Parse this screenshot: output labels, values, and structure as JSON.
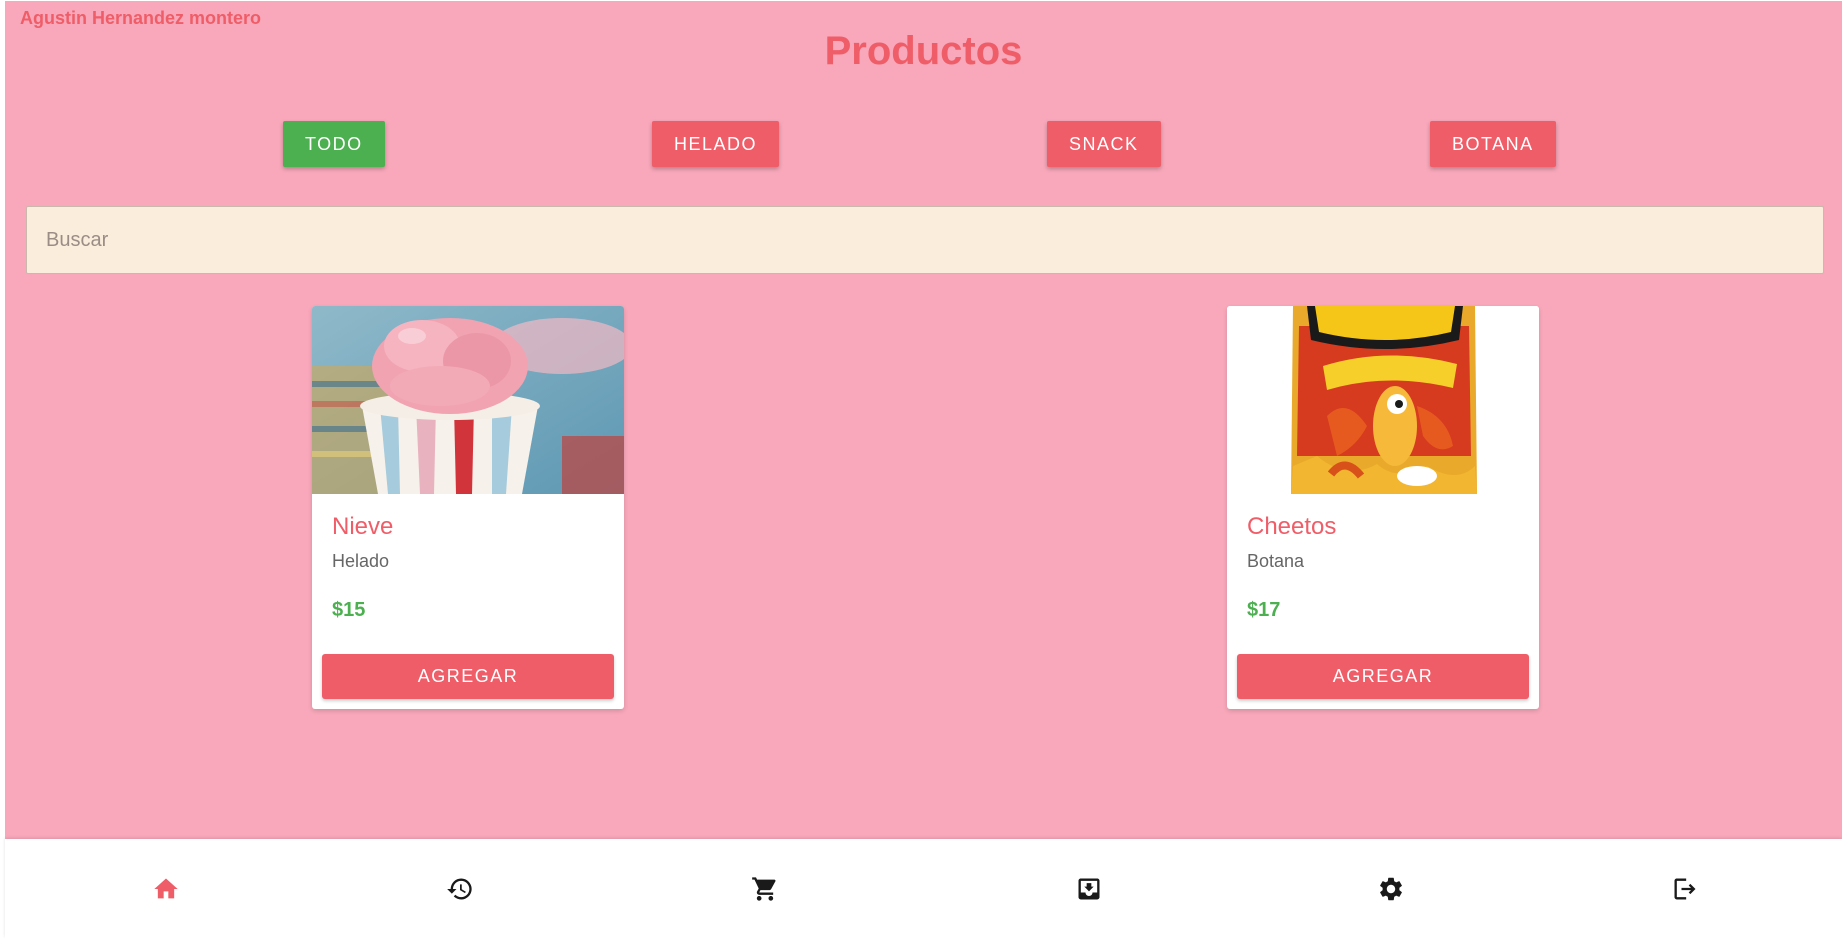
{
  "header": {
    "user_name": "Agustin Hernandez montero",
    "page_title": "Productos"
  },
  "filters": [
    {
      "label": "TODO",
      "active": true
    },
    {
      "label": "HELADO",
      "active": false
    },
    {
      "label": "SNACK",
      "active": false
    },
    {
      "label": "BOTANA",
      "active": false
    }
  ],
  "search": {
    "placeholder": "Buscar",
    "value": ""
  },
  "products": [
    {
      "name": "Nieve",
      "category": "Helado",
      "price": "$15",
      "button_label": "AGREGAR",
      "image": "ice-cream-cup"
    },
    {
      "name": "Cheetos",
      "category": "Botana",
      "price": "$17",
      "button_label": "AGREGAR",
      "image": "cheetos-bag"
    }
  ],
  "bottom_nav": [
    {
      "icon": "home-icon",
      "active": true
    },
    {
      "icon": "history-icon",
      "active": false
    },
    {
      "icon": "cart-icon",
      "active": false
    },
    {
      "icon": "inbox-download-icon",
      "active": false
    },
    {
      "icon": "gear-icon",
      "active": false
    },
    {
      "icon": "logout-icon",
      "active": false
    }
  ],
  "colors": {
    "background": "#f8a8ba",
    "accent": "#ef5d68",
    "active_filter": "#4caf50",
    "price": "#4caf50",
    "search_background": "#fbeddc"
  }
}
